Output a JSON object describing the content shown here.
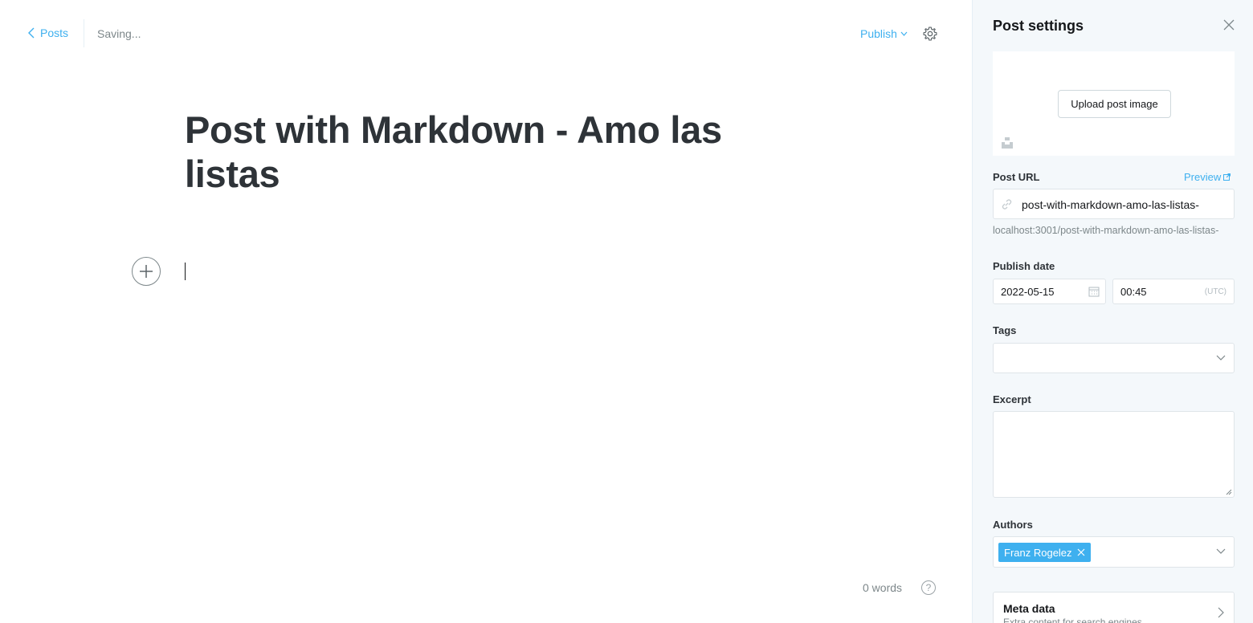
{
  "topbar": {
    "back_label": "Posts",
    "status": "Saving...",
    "publish_label": "Publish"
  },
  "editor": {
    "title": "Post with Markdown - Amo las listas",
    "word_count": "0 words",
    "help_symbol": "?"
  },
  "settings": {
    "title": "Post settings",
    "upload_label": "Upload post image",
    "post_url_label": "Post URL",
    "preview_label": "Preview",
    "slug": "post-with-markdown-amo-las-listas-",
    "full_url": "localhost:3001/post-with-markdown-amo-las-listas-",
    "publish_date_label": "Publish date",
    "date": "2022-05-15",
    "time": "00:45",
    "timezone": "(UTC)",
    "tags_label": "Tags",
    "excerpt_label": "Excerpt",
    "authors_label": "Authors",
    "author": "Franz Rogelez",
    "meta_title": "Meta data",
    "meta_subtitle": "Extra content for search engines"
  },
  "colors": {
    "accent": "#3eb0ef",
    "panel_bg": "#f4f8fb",
    "title_text": "#2e3338"
  },
  "icons": [
    "chevron-left-icon",
    "gear-icon",
    "plus-icon",
    "help-icon",
    "close-icon",
    "unsplash-icon",
    "link-icon",
    "external-link-icon",
    "calendar-icon",
    "chevron-down-icon",
    "chevron-right-icon"
  ]
}
